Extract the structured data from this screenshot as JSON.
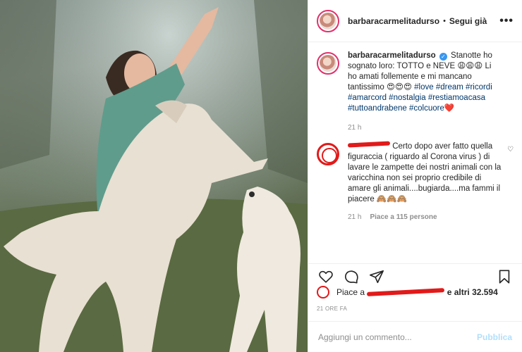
{
  "post": {
    "username": "barbaracarmelitadurso",
    "follow_label": "Segui già",
    "more_label": "•••"
  },
  "caption": {
    "username": "barbaracarmelitadurso",
    "text": "Stanotte ho sognato loro: TOTTO e NEVE 😩😩😩 Li ho amati follemente e mi mancano tantissimo 😍😍😍",
    "hashtags": [
      "#love",
      "#dream",
      "#ricordi",
      "#amarcord",
      "#nostalgia",
      "#restiamoacasa",
      "#tuttoandrabene",
      "#colcuore❤️"
    ],
    "time": "21 h"
  },
  "comment": {
    "text": "Certo dopo aver fatto quella figuraccia ( riguardo al Corona virus ) di lavare le zampette dei nostri animali con la varicchina non sei proprio credibile di amare gli animali....bugiarda....ma fammi il piacere 🙈🙈🙈",
    "time": "21 h",
    "likes": "Piace a 115 persone"
  },
  "likes_line": {
    "prefix": "Piace a",
    "suffix": "e altri 32.594"
  },
  "timestamp": "21 ORE FA",
  "add_comment": {
    "placeholder": "Aggiungi un commento...",
    "publish_label": "Pubblica"
  },
  "icons": [
    "heart-icon",
    "comment-icon",
    "share-icon",
    "bookmark-icon",
    "verified-icon",
    "more-icon"
  ]
}
